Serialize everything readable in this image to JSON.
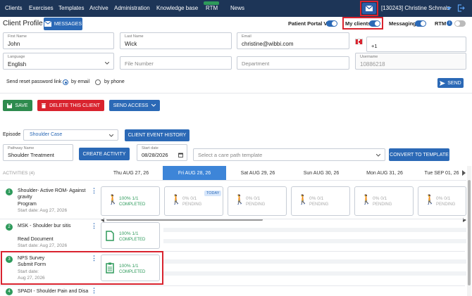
{
  "nav": {
    "items": [
      "Clients",
      "Exercises",
      "Templates",
      "Archive",
      "Administration",
      "Knowledge base",
      "RTM",
      "News"
    ],
    "user": "[130243] Christine Schmalz",
    "icons": [
      "mail-icon",
      "caret-down-icon",
      "logout-icon"
    ]
  },
  "header": {
    "title": "Client Profile",
    "messages_label": "MESSAGES",
    "toggles": [
      {
        "label": "Patient Portal V2",
        "on": true
      },
      {
        "label": "My clients",
        "on": true
      },
      {
        "label": "Messaging",
        "on": true
      },
      {
        "label": "RTM",
        "on": false
      }
    ]
  },
  "form": {
    "first_name": {
      "label": "First Name",
      "value": "John"
    },
    "last_name": {
      "label": "Last Name",
      "value": "Wick"
    },
    "email": {
      "label": "Email",
      "value": "christine@wibbi.com"
    },
    "phone_code": "+1",
    "language": {
      "label": "Language",
      "value": "English"
    },
    "file_number": {
      "placeholder": "File Number"
    },
    "department": {
      "placeholder": "Department"
    },
    "username": {
      "label": "Username",
      "value": "10886218"
    }
  },
  "reset": {
    "label": "Send reset password link",
    "by_email": "by email",
    "by_phone": "by phone",
    "send_label": "SEND"
  },
  "actions": {
    "save": "SAVE",
    "delete": "DELETE THIS CLIENT",
    "send_access": "SEND ACCESS"
  },
  "episode": {
    "label": "Episode",
    "value": "Shoulder Case",
    "history_label": "CLIENT EVENT HISTORY"
  },
  "pathway": {
    "label": "Pathway Name",
    "value": "Shoulder Treatment",
    "create_activity": "CREATE ACTIVITY",
    "start_date_label": "Start date",
    "start_date": "08/28/2026",
    "template_placeholder": "Select a care path template",
    "convert_label": "CONVERT TO TEMPLATE"
  },
  "timeline": {
    "activities_label": "ACTIVITIES (4)",
    "days": [
      "Thu AUG 27, 26",
      "Fri AUG 28, 26",
      "Sat AUG 29, 26",
      "Sun AUG 30, 26",
      "Mon AUG 31, 26",
      "Tue SEP 01, 26"
    ],
    "today_label": "TODAY"
  },
  "activities": [
    {
      "num": "1",
      "title": "Shoulder- Active ROM- Against gravity",
      "sub": "Program",
      "date": "Start date: Aug 27, 2026"
    },
    {
      "num": "2",
      "title": "MSK - Shoulder bur sitis",
      "sub": "Read Document",
      "date": "Start date: Aug 27, 2026"
    },
    {
      "num": "3",
      "title": "NPS Survey",
      "sub": "Submit Form",
      "date": "Start date:",
      "date2": "Aug 27, 2026"
    },
    {
      "num": "4",
      "title": "SPADI - Shoulder Pain and Disa",
      "sub": "",
      "date": ""
    }
  ],
  "cards": {
    "row1": [
      {
        "pct": "100% 1/1",
        "status": "COMPLETED"
      },
      {
        "pct": "0% 0/1",
        "status": "PENDING"
      },
      {
        "pct": "0% 0/1",
        "status": "PENDING"
      },
      {
        "pct": "0% 0/1",
        "status": "PENDING"
      },
      {
        "pct": "0% 0/1",
        "status": "PENDING"
      },
      {
        "pct": "0% 0/1",
        "status": "PENDING"
      }
    ],
    "row2": {
      "pct": "100% 1/1",
      "status": "COMPLETED"
    },
    "row3": {
      "pct": "100% 1/1",
      "status": "COMPLETED"
    }
  },
  "colors": {
    "nav": "#1d3557",
    "primary": "#2b69b6",
    "success": "#2e9a5b",
    "danger": "#d9232e"
  }
}
